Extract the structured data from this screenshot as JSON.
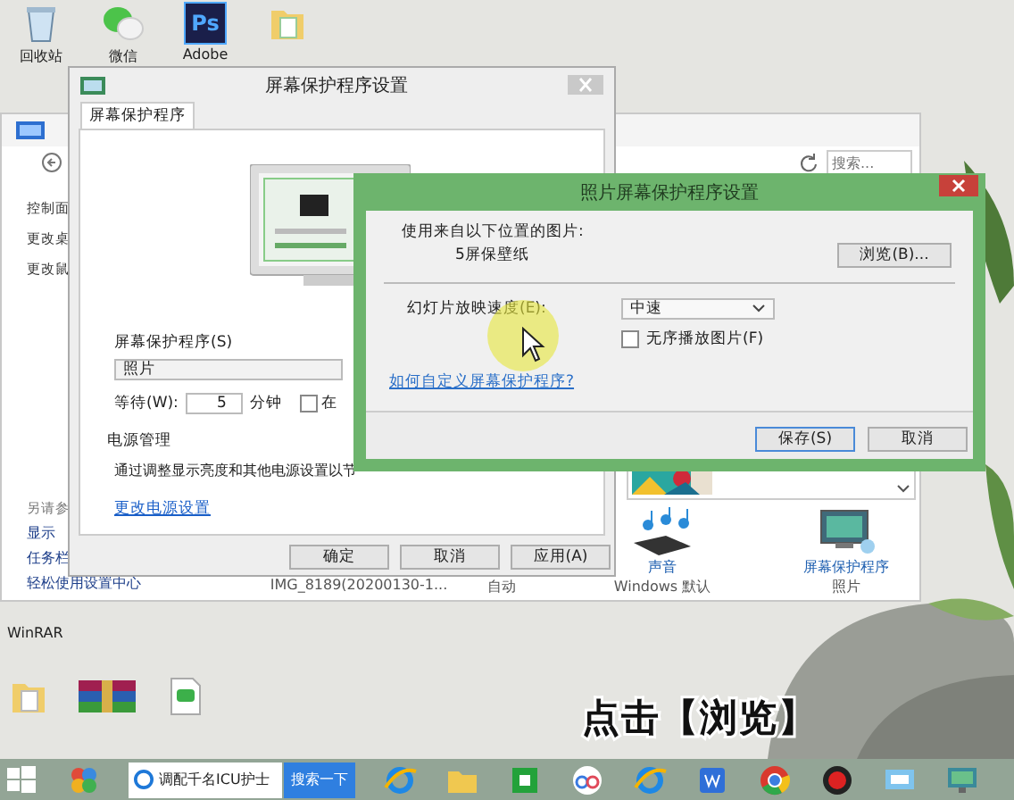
{
  "desktop_top": [
    {
      "kind": "recycle",
      "label": "回收站"
    },
    {
      "kind": "wechat",
      "label": "微信"
    },
    {
      "kind": "ps",
      "glyph": "Ps",
      "label": "Adobe"
    },
    {
      "kind": "folder"
    }
  ],
  "desktop_labels": [
    "WinRAR"
  ],
  "desktop_bottom": [
    {
      "kind": "folder"
    },
    {
      "kind": "winrar"
    },
    {
      "kind": "doc"
    }
  ],
  "control_panel": {
    "nav": [
      "控制面",
      "更改桌",
      "更改鼠"
    ],
    "see_also": {
      "title": "另请参",
      "links": [
        "显示",
        "任务栏",
        "轻松使用设置中心"
      ]
    },
    "search": {
      "placeholder": "搜索..."
    },
    "settings": [
      {
        "subtitle": "IMG_8189(20200130-1..."
      },
      {
        "subtitle": "自动"
      },
      {
        "kind": "sound",
        "title": "声音",
        "subtitle": "Windows 默认"
      },
      {
        "kind": "screensaver",
        "title": "屏幕保护程序",
        "subtitle": "照片"
      }
    ]
  },
  "screensaver_dialog": {
    "title": "屏幕保护程序设置",
    "tabs": [
      {
        "label": "屏幕保护程序",
        "selected": true
      }
    ],
    "saver_label": "屏幕保护程序(S)",
    "saver_value": "照片",
    "wait_label": "等待(W):",
    "wait_value": "5",
    "wait_unit": "分钟",
    "resume": {
      "label": "在",
      "checked": false
    },
    "power": {
      "title": "电源管理",
      "text": "通过调整显示亮度和其他电源设置以节",
      "link": "更改电源设置"
    },
    "buttons": [
      "确定",
      "取消",
      "应用(A)"
    ]
  },
  "photo_dialog": {
    "title": "照片屏幕保护程序设置",
    "source_label": "使用来自以下位置的图片:",
    "source_value": "5屏保壁纸",
    "browse": "浏览(B)...",
    "speed_label": "幻灯片放映速度(E):",
    "speed_value": "中速",
    "shuffle": {
      "label": "无序播放图片(F)",
      "checked": false
    },
    "help_link": "如何自定义屏幕保护程序?",
    "buttons": [
      "保存(S)",
      "取消"
    ]
  },
  "subtitle": "点击【浏览】",
  "taskbar": {
    "items": [
      {
        "kind": "start"
      },
      {
        "kind": "apps"
      },
      {
        "kind": "ie_tab",
        "label": "调配千名ICU护士"
      },
      {
        "kind": "search",
        "label": "搜索一下"
      },
      {
        "kind": "ie"
      },
      {
        "kind": "folder"
      },
      {
        "kind": "store"
      },
      {
        "kind": "cloud"
      },
      {
        "kind": "ie"
      },
      {
        "kind": "wps"
      },
      {
        "kind": "chrome"
      },
      {
        "kind": "record"
      },
      {
        "kind": "remote"
      },
      {
        "kind": "display"
      }
    ]
  }
}
